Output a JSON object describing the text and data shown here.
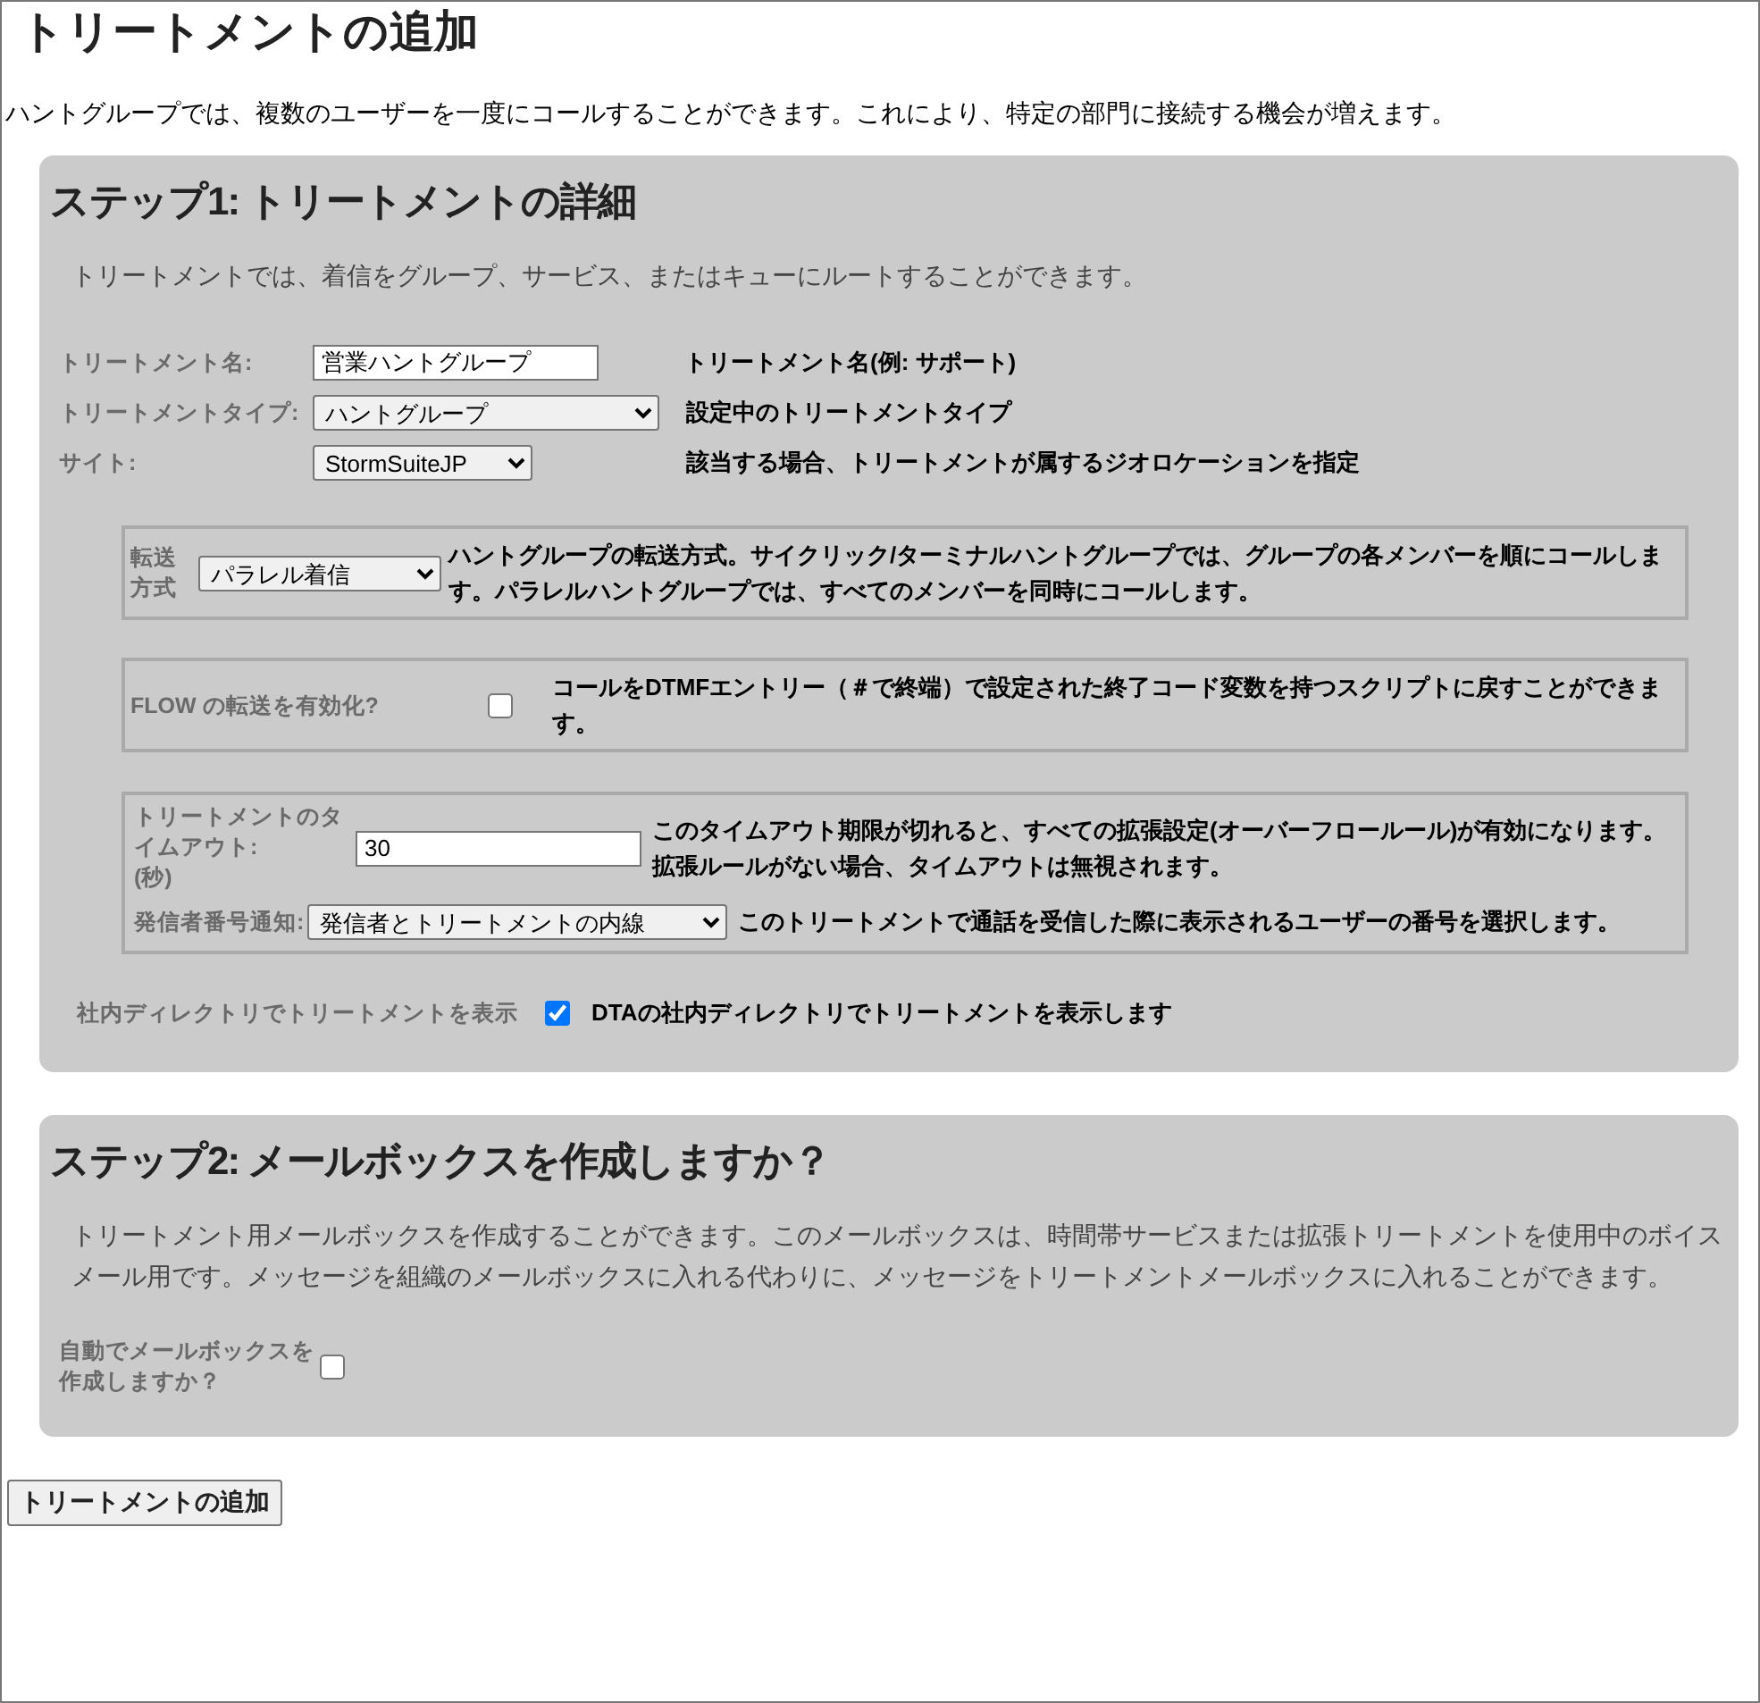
{
  "page": {
    "title": "トリートメントの追加",
    "intro": "ハントグループでは、複数のユーザーを一度にコールすることができます。これにより、特定の部門に接続する機会が増えます。"
  },
  "step1": {
    "heading": "ステップ1: トリートメントの詳細",
    "description": "トリートメントでは、着信をグループ、サービス、またはキューにルートすることができます。",
    "fields": [
      {
        "kind": "text",
        "label": "トリートメント名:",
        "value": "営業ハントグループ",
        "help": "トリートメント名(例: サポート)"
      },
      {
        "kind": "select",
        "label": "トリートメントタイプ:",
        "value": "ハントグループ",
        "help": "設定中のトリートメントタイプ"
      },
      {
        "kind": "site",
        "label": "サイト:",
        "value": "StormSuiteJP",
        "help": "該当する場合、トリートメントが属するジオロケーションを指定"
      }
    ],
    "forwarding": {
      "label": "転送方式",
      "value": "パラレル着信",
      "help": "ハントグループの転送方式。サイクリック/ターミナルハントグループでは、グループの各メンバーを順にコールします。パラレルハントグループでは、すべてのメンバーを同時にコールします。"
    },
    "flow": {
      "label": "FLOW の転送を有効化?",
      "checked": false,
      "help": "コールをDTMFエントリー（＃で終端）で設定された終了コード変数を持つスクリプトに戻すことができます。"
    },
    "timeout": {
      "label": "トリートメントのタイムアウト:",
      "unit": "(秒)",
      "value": "30",
      "help": "このタイムアウト期限が切れると、すべての拡張設定(オーバーフロールール)が有効になります。拡張ルールがない場合、タイムアウトは無視されます。"
    },
    "caller_id": {
      "label": "発信者番号通知:",
      "value": "発信者とトリートメントの内線",
      "help": "このトリートメントで通話を受信した際に表示されるユーザーの番号を選択します。"
    },
    "directory": {
      "label": "社内ディレクトリでトリートメントを表示",
      "checked": true,
      "help": "DTAの社内ディレクトリでトリートメントを表示します"
    }
  },
  "step2": {
    "heading": "ステップ2: メールボックスを作成しますか？",
    "description": "トリートメント用メールボックスを作成することができます。このメールボックスは、時間帯サービスまたは拡張トリートメントを使用中のボイスメール用です。メッセージを組織のメールボックスに入れる代わりに、メッセージをトリートメントメールボックスに入れることができます。",
    "auto_mailbox": {
      "label": "自動でメールボックスを作成しますか？",
      "checked": false
    }
  },
  "submit_button": "トリートメントの追加"
}
